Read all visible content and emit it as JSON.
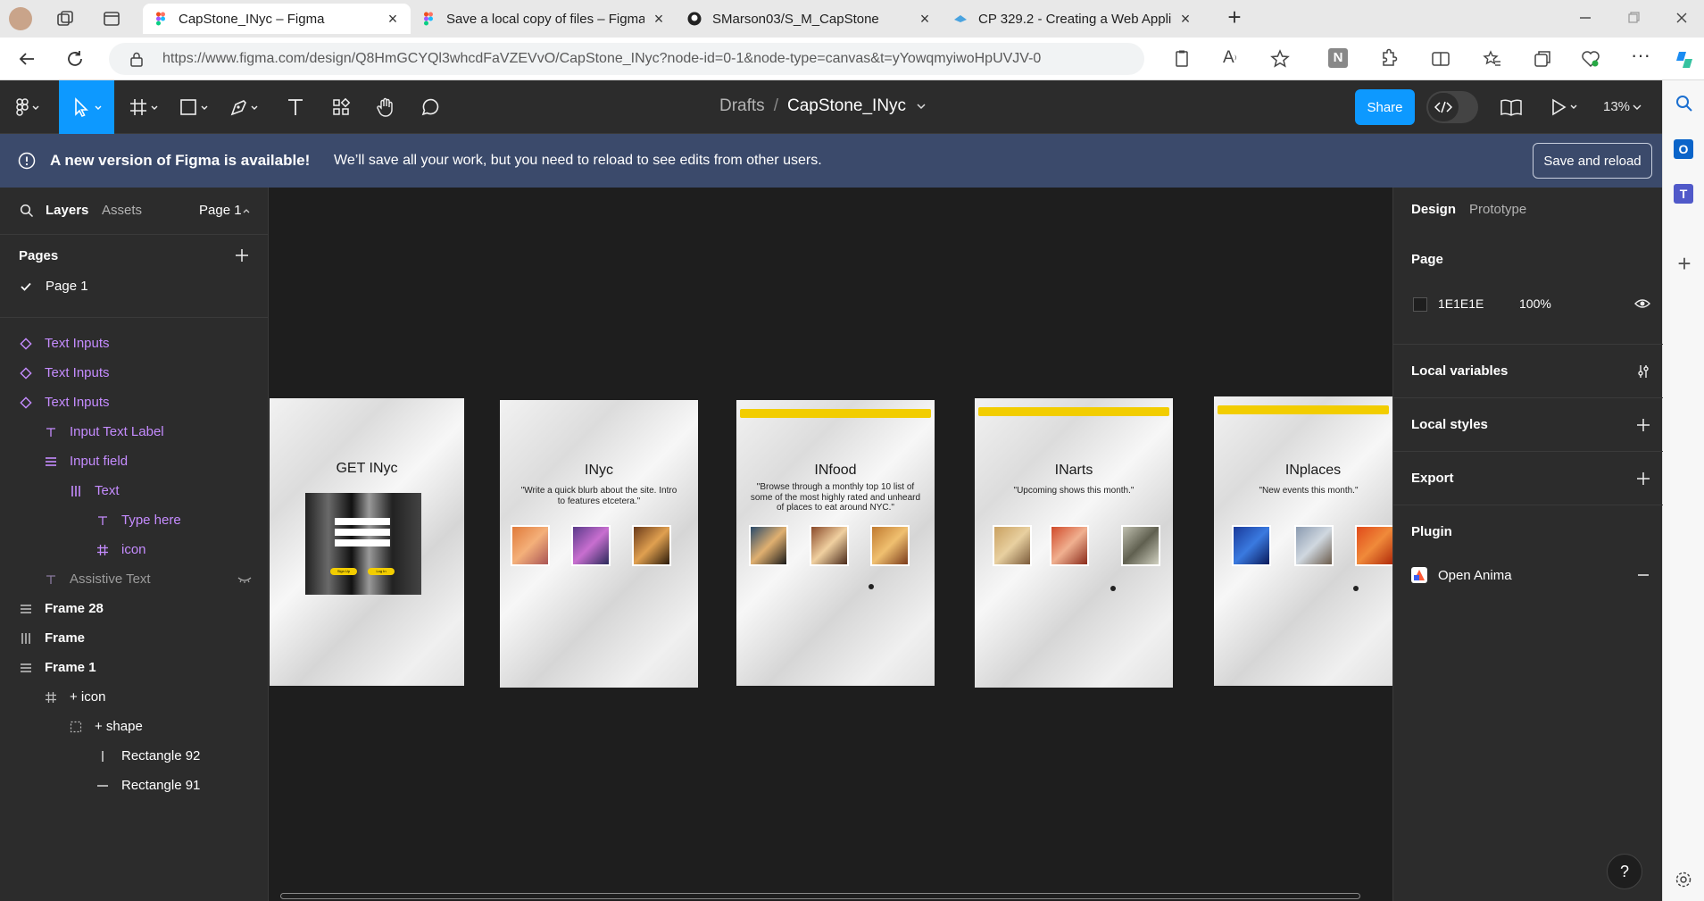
{
  "browser": {
    "tabs": [
      {
        "title": "CapStone_INyc – Figma",
        "active": true,
        "favicon": "figma-icon"
      },
      {
        "title": "Save a local copy of files – Figma",
        "active": false,
        "favicon": "figma-icon"
      },
      {
        "title": "SMarson03/S_M_CapStone",
        "active": false,
        "favicon": "github-icon"
      },
      {
        "title": "CP 329.2 - Creating a Web Applic",
        "active": false,
        "favicon": "course-icon"
      }
    ],
    "url": "https://www.figma.com/design/Q8HmGCYQl3whcdFaVZEVvO/CapStone_INyc?node-id=0-1&node-type=canvas&t=yYowqmyiwoHpUVJV-0"
  },
  "toolbar": {
    "breadcrumb_root": "Drafts",
    "breadcrumb_sep": "/",
    "file_name": "CapStone_INyc",
    "share_label": "Share",
    "zoom": "13%"
  },
  "banner": {
    "title": "A new version of Figma is available!",
    "message": "We’ll save all your work, but you need to reload to see edits from other users.",
    "button": "Save and reload"
  },
  "left_panel": {
    "tabs": {
      "layers": "Layers",
      "assets": "Assets",
      "page": "Page 1"
    },
    "pages_heading": "Pages",
    "current_page": "Page 1",
    "layers": [
      {
        "name": "Text Inputs",
        "icon": "component-icon",
        "color": "purple"
      },
      {
        "name": "Text Inputs",
        "icon": "component-icon",
        "color": "purple"
      },
      {
        "name": "Text Inputs",
        "icon": "component-icon",
        "color": "purple"
      },
      {
        "name": "Input Text Label",
        "icon": "text-icon",
        "color": "purple"
      },
      {
        "name": "Input field",
        "icon": "autolayout-vertical-icon",
        "color": "purple"
      },
      {
        "name": "Text",
        "icon": "autolayout-horizontal-icon",
        "color": "purple"
      },
      {
        "name": "Type here",
        "icon": "text-icon",
        "color": "purple"
      },
      {
        "name": "icon",
        "icon": "frame-icon",
        "color": "purple"
      },
      {
        "name": "Assistive Text",
        "icon": "text-icon",
        "color": "grey"
      },
      {
        "name": "Frame 28",
        "icon": "autolayout-vertical-icon",
        "color": "white"
      },
      {
        "name": "Frame",
        "icon": "autolayout-horizontal-icon",
        "color": "white"
      },
      {
        "name": "Frame 1",
        "icon": "autolayout-vertical-icon",
        "color": "white"
      },
      {
        "name": "+ icon",
        "icon": "frame-icon",
        "color": "white"
      },
      {
        "name": "+ shape",
        "icon": "group-icon",
        "color": "white"
      },
      {
        "name": "Rectangle 92",
        "icon": "vertical-line-icon",
        "color": "white"
      },
      {
        "name": "Rectangle 91",
        "icon": "horizontal-line-icon",
        "color": "white"
      }
    ]
  },
  "canvas": {
    "frames": [
      {
        "title": "GET INyc",
        "quote": ""
      },
      {
        "title": "INyc",
        "quote": "\"Write a quick blurb about the site. Intro to features etcetera.\""
      },
      {
        "title": "INfood",
        "quote": "\"Browse through a monthly top 10 list of some of the most highly rated and unheard of places to eat around NYC.\""
      },
      {
        "title": "INarts",
        "quote": "\"Upcoming shows this month.\""
      },
      {
        "title": "INplaces",
        "quote": "\"New events this month.\""
      }
    ],
    "login_buttons": [
      "Sign Up",
      "Log In"
    ]
  },
  "right_panel": {
    "tabs": {
      "design": "Design",
      "prototype": "Prototype"
    },
    "page_heading": "Page",
    "page_color": "1E1E1E",
    "page_opacity": "100%",
    "sections": [
      "Local variables",
      "Local styles",
      "Export",
      "Plugin"
    ],
    "plugin_name": "Open Anima"
  },
  "colors": {
    "figma_blue": "#0d99ff",
    "banner_bg": "#3b4a6b",
    "canvas_bg": "#1e1e1e",
    "component_purple": "#c58cff"
  }
}
